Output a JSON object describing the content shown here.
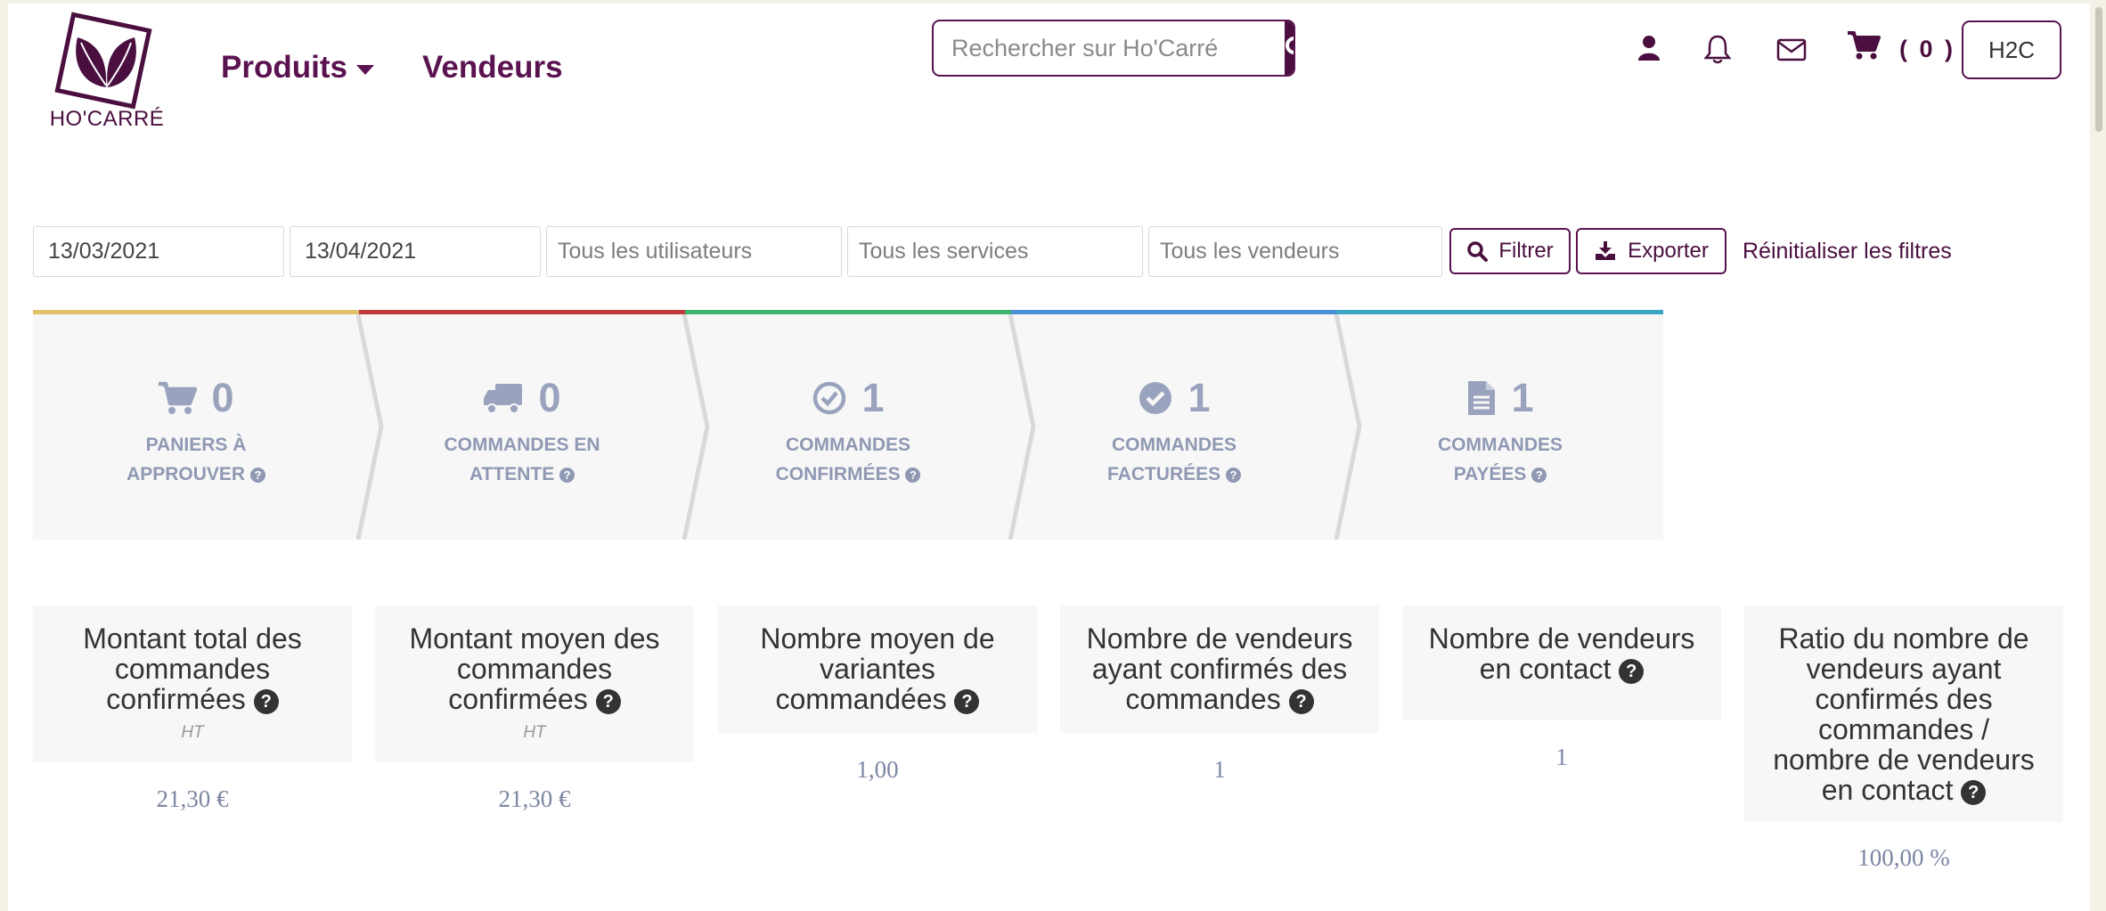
{
  "header": {
    "logo_text": "HO'CARRÉ",
    "nav": [
      {
        "label": "Produits"
      },
      {
        "label": "Vendeurs"
      }
    ],
    "search_placeholder": "Rechercher sur Ho'Carré",
    "cart_count": "( 0 )",
    "account_type": "H2C"
  },
  "filters": {
    "date_from": "13/03/2021",
    "date_to": "13/04/2021",
    "users_placeholder": "Tous les utilisateurs",
    "services_placeholder": "Tous les services",
    "vendors_placeholder": "Tous les vendeurs",
    "filter_label": "Filtrer",
    "export_label": "Exporter",
    "reset_label": "Réinitialiser les filtres"
  },
  "steps": [
    {
      "count": "0",
      "line1": "PANIERS À",
      "line2": "APPROUVER",
      "icon": "cart-icon",
      "color": "#e3c06a"
    },
    {
      "count": "0",
      "line1": "COMMANDES EN",
      "line2": "ATTENTE",
      "icon": "truck-icon",
      "color": "#c0393b"
    },
    {
      "count": "1",
      "line1": "COMMANDES",
      "line2": "CONFIRMÉES",
      "icon": "check-circle-outline-icon",
      "color": "#3db46d"
    },
    {
      "count": "1",
      "line1": "COMMANDES",
      "line2": "FACTURÉES",
      "icon": "check-circle-icon",
      "color": "#4a90d9"
    },
    {
      "count": "1",
      "line1": "COMMANDES",
      "line2": "PAYÉES",
      "icon": "document-icon",
      "color": "#3aa6c4"
    }
  ],
  "stats": [
    {
      "lines": [
        "Montant total des",
        "commandes",
        "confirmées"
      ],
      "sub": "HT",
      "value": "21,30 €"
    },
    {
      "lines": [
        "Montant moyen des",
        "commandes",
        "confirmées"
      ],
      "sub": "HT",
      "value": "21,30 €"
    },
    {
      "lines": [
        "Nombre moyen de",
        "variantes",
        "commandées"
      ],
      "sub": "",
      "value": "1,00"
    },
    {
      "lines": [
        "Nombre de vendeurs",
        "ayant confirmés des",
        "commandes"
      ],
      "sub": "",
      "value": "1"
    },
    {
      "lines": [
        "Nombre de vendeurs",
        "en contact"
      ],
      "sub": "",
      "value": "1"
    },
    {
      "lines": [
        "Ratio du nombre de",
        "vendeurs ayant",
        "confirmés des",
        "commandes /",
        "nombre de vendeurs",
        "en contact"
      ],
      "sub": "",
      "value": "100,00 %"
    }
  ]
}
